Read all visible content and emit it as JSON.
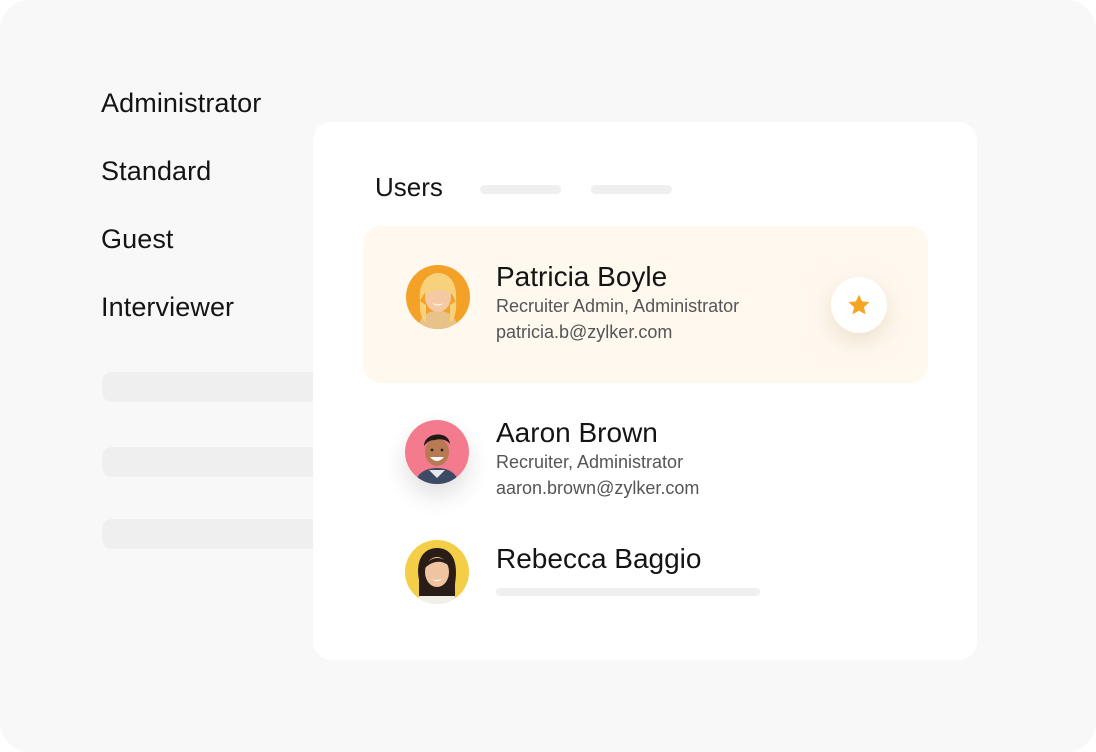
{
  "roles": [
    "Administrator",
    "Standard",
    "Guest",
    "Interviewer"
  ],
  "users_card": {
    "title": "Users",
    "users": [
      {
        "name": "Patricia Boyle",
        "role": "Recruiter Admin, Administrator",
        "email": "patricia.b@zylker.com",
        "highlighted": true,
        "starred": true,
        "avatar_bg": "#f3a127"
      },
      {
        "name": "Aaron Brown",
        "role": "Recruiter, Administrator",
        "email": "aaron.brown@zylker.com",
        "highlighted": false,
        "starred": false,
        "avatar_bg": "#f47a8e"
      },
      {
        "name": "Rebecca Baggio",
        "highlighted": false,
        "starred": false,
        "avatar_bg": "#f5ce47"
      }
    ]
  },
  "colors": {
    "star": "#f5a623",
    "highlight_row": "#fef8ef",
    "placeholder": "#efefef"
  },
  "icons": {
    "favorite": "star-icon"
  }
}
